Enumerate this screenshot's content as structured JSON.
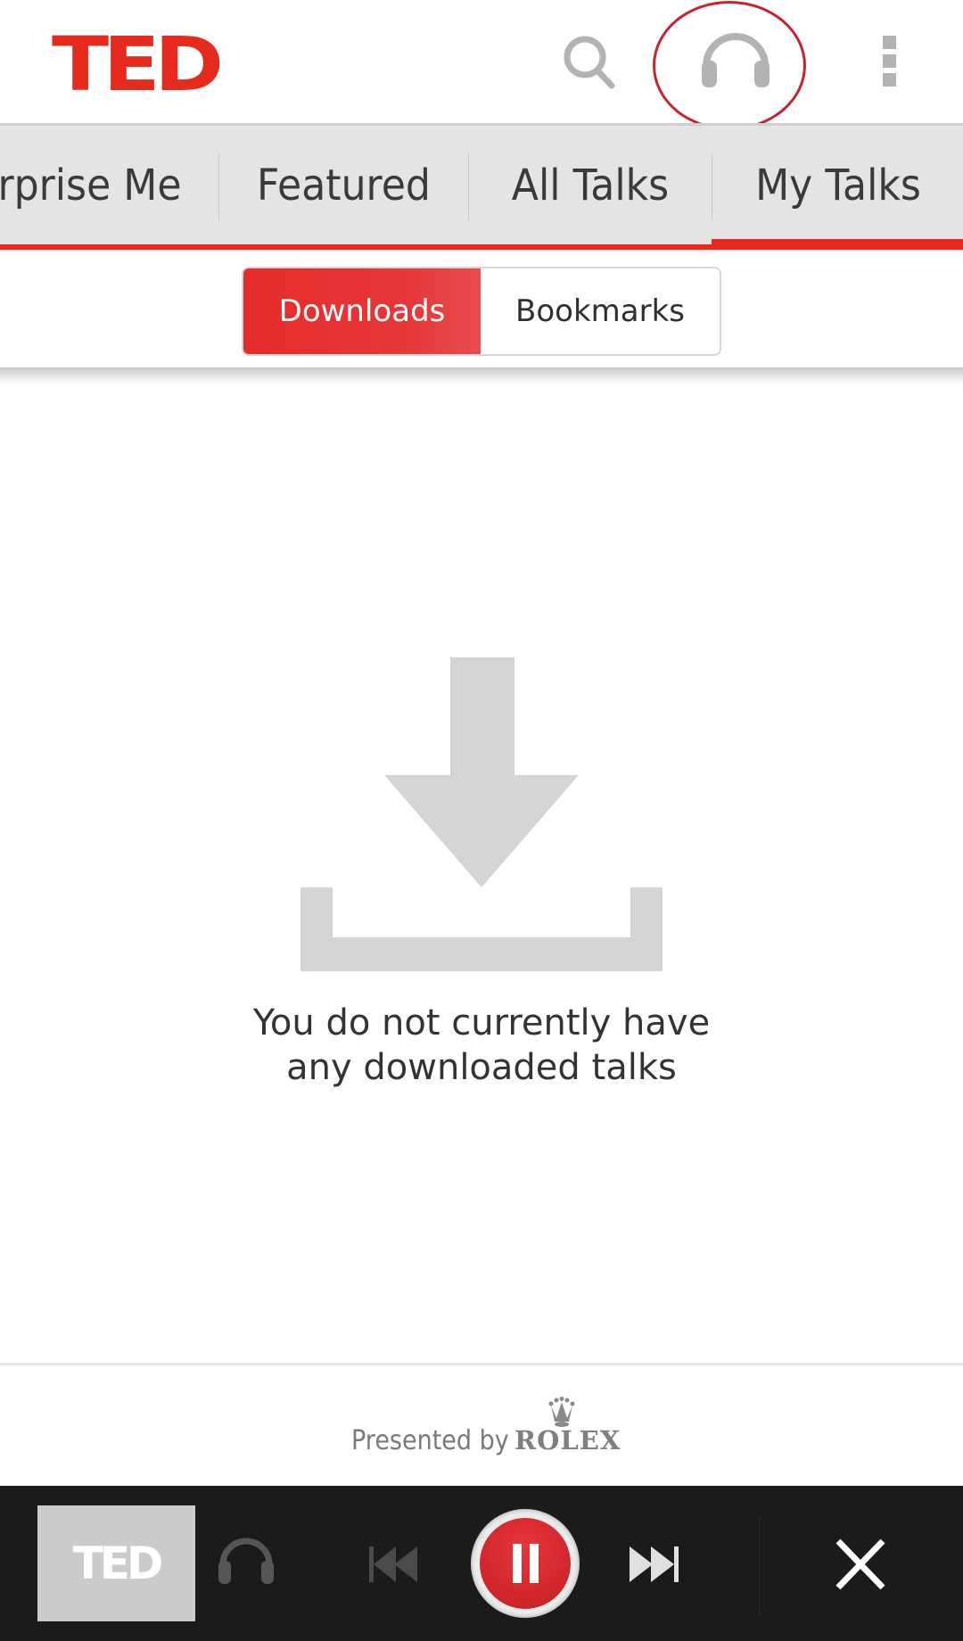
{
  "header": {
    "logo_text": "TED",
    "icons": [
      "search-icon",
      "headphones-icon",
      "overflow-menu-icon"
    ],
    "brand_color": "#e62b1e",
    "annotation_color": "#c9222f"
  },
  "tabs": {
    "items": [
      {
        "label": "rprise Me",
        "full_label": "Surprise Me"
      },
      {
        "label": "Featured"
      },
      {
        "label": "All Talks"
      },
      {
        "label": "My Talks",
        "active": true
      }
    ]
  },
  "segmented": {
    "options": [
      {
        "label": "Downloads",
        "selected": true
      },
      {
        "label": "Bookmarks",
        "selected": false
      }
    ]
  },
  "empty_state": {
    "icon": "download-icon",
    "line1": "You do not currently have",
    "line2": "any downloaded talks"
  },
  "sponsor": {
    "label": "Presented by",
    "brand": "ROLEX",
    "icon": "crown-icon"
  },
  "player": {
    "thumbnail_text": "TED",
    "controls": [
      "headphones-icon",
      "previous-icon",
      "pause-icon",
      "next-icon",
      "close-icon"
    ],
    "state": "playing"
  }
}
